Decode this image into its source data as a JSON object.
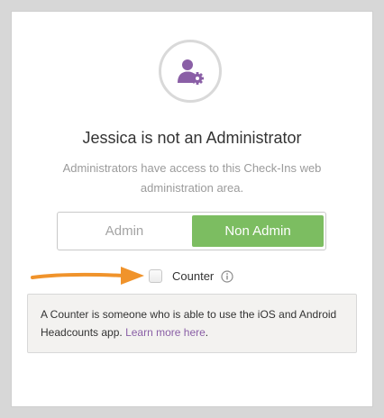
{
  "dialog": {
    "title": "Jessica is not an Administrator",
    "description": "Administrators have access to this Check-Ins web administration area.",
    "avatar_icon": "user-gear-icon",
    "accent_color": "#8a5fa6"
  },
  "role_toggle": {
    "options": [
      {
        "label": "Admin",
        "selected": false
      },
      {
        "label": "Non Admin",
        "selected": true
      }
    ],
    "selected_color": "#7cbd61"
  },
  "counter": {
    "label": "Counter",
    "checked": false,
    "info_icon": "info-icon"
  },
  "info_box": {
    "text": "A Counter is someone who is able to use the iOS and Android Headcounts app.",
    "link_text": "Learn more here",
    "trailing": "."
  },
  "annotation": {
    "arrow_icon": "arrow-right-icon",
    "color": "#f0932b"
  }
}
